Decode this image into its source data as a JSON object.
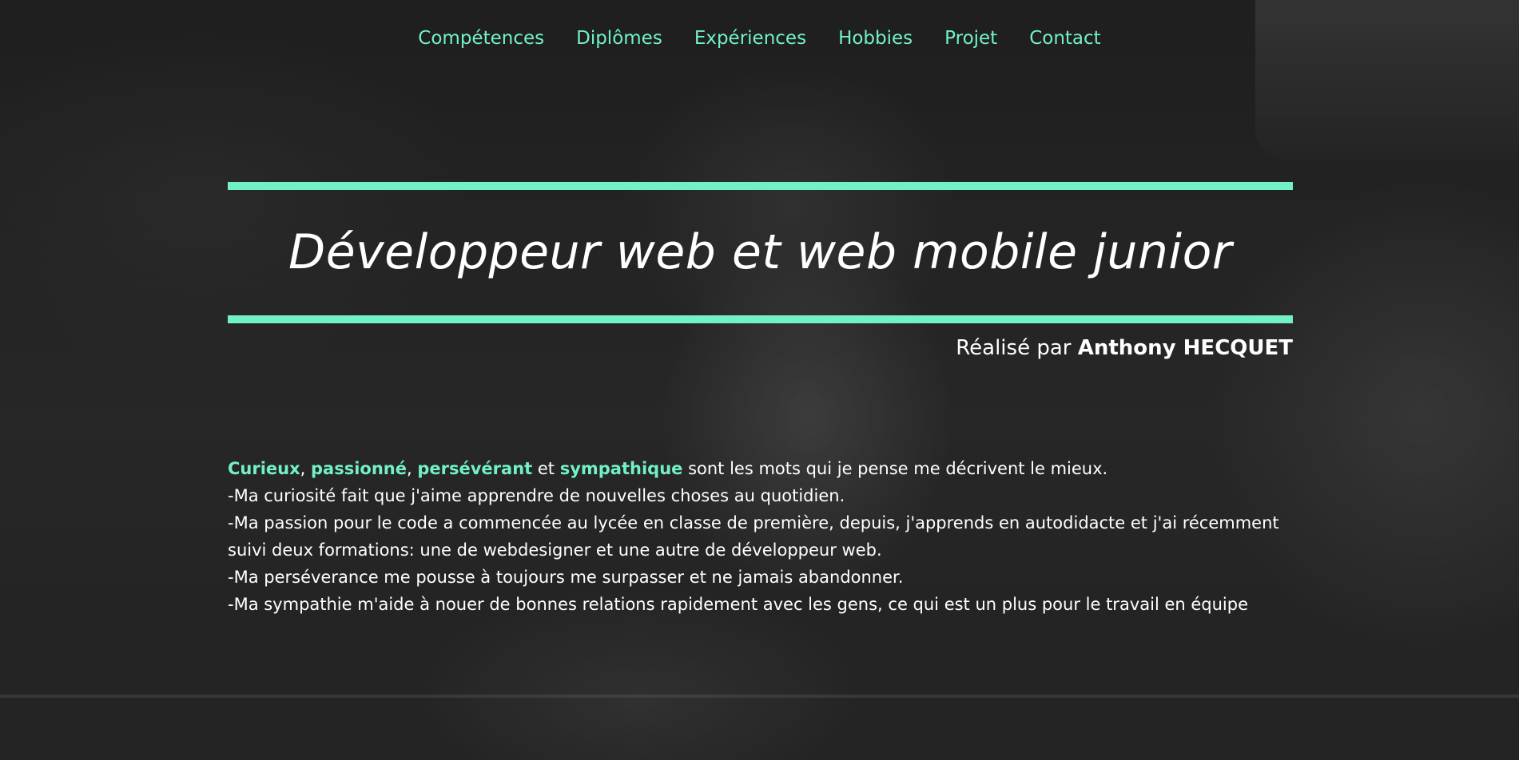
{
  "nav": {
    "items": [
      {
        "label": "Compétences"
      },
      {
        "label": "Diplômes"
      },
      {
        "label": "Expériences"
      },
      {
        "label": "Hobbies"
      },
      {
        "label": "Projet"
      },
      {
        "label": "Contact"
      }
    ]
  },
  "hero": {
    "title": "Développeur web et web mobile junior",
    "byline_prefix": "Réalisé par ",
    "author": "Anthony HECQUET"
  },
  "intro": {
    "keywords": [
      "Curieux",
      "passionné",
      "persévérant",
      "sympathique"
    ],
    "sep1": ", ",
    "sep2": ", ",
    "sep3": " et ",
    "lead_rest": " sont les mots qui je pense me décrivent le mieux.",
    "lines": [
      "-Ma curiosité fait que j'aime apprendre de nouvelles choses au quotidien.",
      "-Ma passion pour le code a commencée au lycée en classe de première, depuis, j'apprends en autodidacte et j'ai récemment suivi deux formations: une de webdesigner et une autre de développeur web.",
      "-Ma perséverance me pousse à toujours me surpasser et ne jamais abandonner.",
      "-Ma sympathie m'aide à nouer de bonnes relations rapidement avec les gens, ce qui est un plus pour le travail en équipe"
    ]
  },
  "colors": {
    "accent": "#72f2c4",
    "text": "#ffffff",
    "background": "#2a2a2a"
  }
}
